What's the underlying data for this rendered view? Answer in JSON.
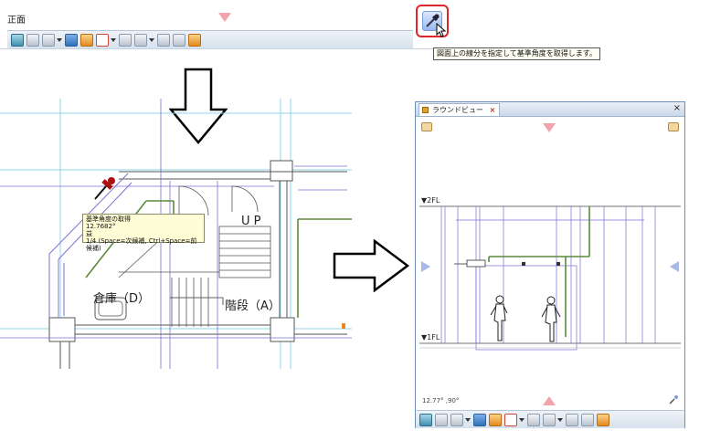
{
  "top_panel": {
    "view_label": "正面",
    "tooltip": "図面上の線分を指定して基準角度を取得します。"
  },
  "plan": {
    "tip_line1": "基準角度の取得",
    "tip_line2": "12.7682°",
    "tip_line3": "益",
    "tip_line4": "1/4 (Space=次候補, Ctrl+Space=前候補)",
    "label_up": "U P",
    "label_storage": "倉庫（D）",
    "label_stairs": "階段（A）"
  },
  "round_view": {
    "tab_title": "ラウンドビュー",
    "tab_close": "×",
    "window_close": "×",
    "floor_2": "▼2FL",
    "floor_1": "▼1FL",
    "angle_readout": "12.77° ,90°"
  },
  "colors": {
    "accent_red": "#e0262a",
    "nav_triangle_pink": "#f2a3ab",
    "nav_triangle_blue": "#a9b8e8",
    "plan_line_purple": "#7b6fd6",
    "plan_line_cyan": "#8fd6e8",
    "pipe_green": "#5b8a3c"
  },
  "icons": {
    "eyedropper": "eyedropper-icon",
    "down_arrow": "down-arrow-icon",
    "right_arrow": "right-arrow-icon"
  }
}
